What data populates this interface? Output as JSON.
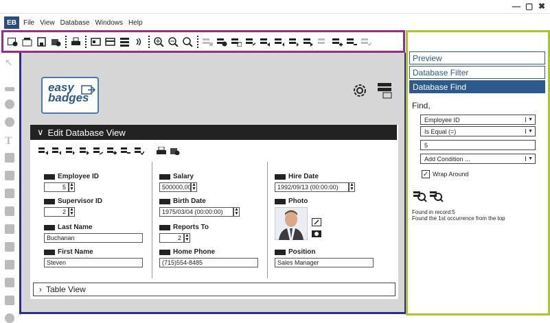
{
  "window": {
    "controls": [
      "—",
      "▢",
      "✖"
    ]
  },
  "app": {
    "logo": "EB"
  },
  "menu": [
    "File",
    "View",
    "Database",
    "Windows",
    "Help"
  ],
  "toolbar": {
    "icons": [
      "new-record-icon",
      "open-icon",
      "save-icon",
      "delete-icon",
      "print-icon",
      "card-icon",
      "card2-icon",
      "list-icon",
      "rfid-icon",
      "zoom-in-icon",
      "zoom-out-icon",
      "zoom-fit-icon",
      "db-filter-icon",
      "db-delete-icon",
      "db-sync-icon",
      "db-undo-icon",
      "db-first-icon",
      "db-prev-icon",
      "db-next-icon",
      "db-last-icon",
      "db-add-icon",
      "db-remove-icon",
      "db-check-icon"
    ]
  },
  "canvas": {
    "logo_line1": "easy",
    "logo_line2": "badges",
    "panel_title": "Edit Database View",
    "fields": {
      "employee_id": {
        "label": "Employee ID",
        "value": "5"
      },
      "supervisor_id": {
        "label": "Supervisor ID",
        "value": "2"
      },
      "last_name": {
        "label": "Last Name",
        "value": "Buchanan"
      },
      "first_name": {
        "label": "First Name",
        "value": "Steven"
      },
      "salary": {
        "label": "Salary",
        "value": "500000,00"
      },
      "birth_date": {
        "label": "Birth Date",
        "value": "1975/03/04 (00:00:00)"
      },
      "reports_to": {
        "label": "Reports To",
        "value": "2"
      },
      "home_phone": {
        "label": "Home Phone",
        "value": "(715)554-8485"
      },
      "hire_date": {
        "label": "Hire Date",
        "value": "1992/09/13 (00:00:00)"
      },
      "photo": {
        "label": "Photo"
      },
      "position": {
        "label": "Position",
        "value": "Sales Manager"
      }
    },
    "table_view": "Table View"
  },
  "rightpanel": {
    "tabs": [
      "Preview",
      "Database Filter",
      "Database Find"
    ],
    "find_label": "Find,",
    "field_select": "Employee ID",
    "operator_select": "Is Equal (=)",
    "value": "5",
    "add_condition": "Add Condition ...",
    "wrap_around": "Wrap Around",
    "result_line1": "Found in record:5",
    "result_line2": "Found the 1st occurrence from the top"
  },
  "colors": {
    "toolbar_border": "#9a2b8a",
    "canvas_border": "#2c2c8a",
    "right_border": "#a8c628",
    "accent": "#2c5a8c"
  }
}
